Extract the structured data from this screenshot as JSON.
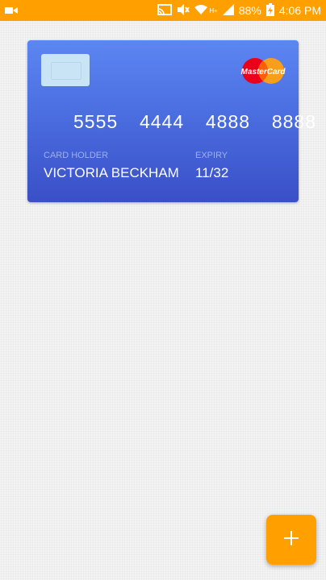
{
  "status_bar": {
    "battery_percent": "88%",
    "time": "4:06 PM",
    "network_label": "H+",
    "color": "#ffa000",
    "icons": [
      "video-camera-icon",
      "cast-icon",
      "mute-icon",
      "wifi-icon",
      "signal-icon",
      "battery-charging-icon"
    ]
  },
  "card": {
    "number": "5555  4444  4888  8888",
    "holder_label": "CARD HOLDER",
    "holder_name": "VICTORIA BECKHAM",
    "expiry_label": "EXPIRY",
    "expiry": "11/32",
    "brand": "MasterCard",
    "gradient": [
      "#5c86f2",
      "#3a4fc7"
    ]
  },
  "fab": {
    "icon": "plus-icon",
    "color": "#ffa000"
  }
}
